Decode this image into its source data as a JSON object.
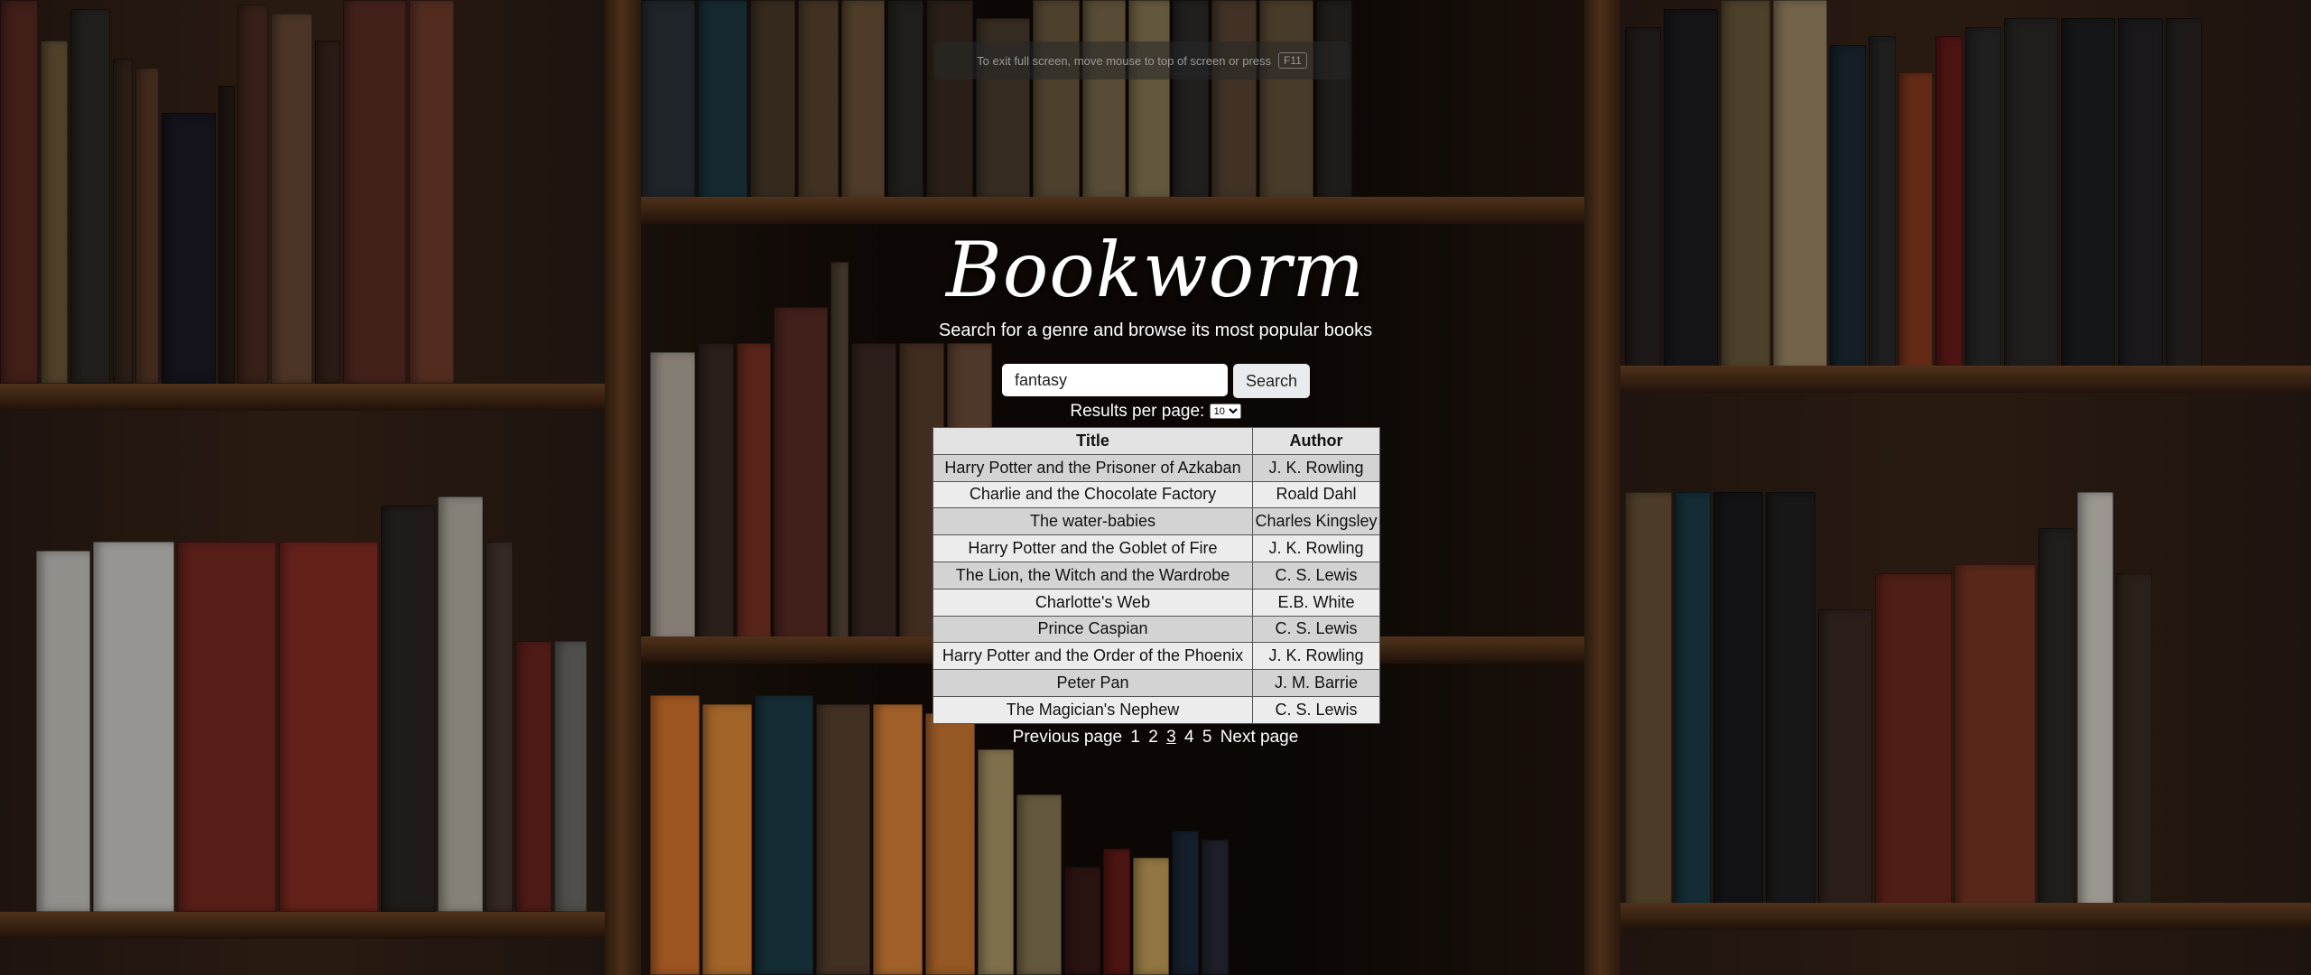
{
  "fullscreen_notice": {
    "text": "To exit full screen, move mouse to top of screen or press",
    "key": "F11"
  },
  "app": {
    "logo": "Bookworm",
    "subtitle": "Search for a genre and browse its most popular books"
  },
  "search": {
    "value": "fantasy",
    "button_label": "Search"
  },
  "results_per_page": {
    "label": "Results per page:",
    "selected": "10"
  },
  "table": {
    "headers": {
      "title": "Title",
      "author": "Author"
    },
    "rows": [
      {
        "title": "Harry Potter and the Prisoner of Azkaban",
        "author": "J. K. Rowling"
      },
      {
        "title": "Charlie and the Chocolate Factory",
        "author": "Roald Dahl"
      },
      {
        "title": "The water-babies",
        "author": "Charles Kingsley"
      },
      {
        "title": "Harry Potter and the Goblet of Fire",
        "author": "J. K. Rowling"
      },
      {
        "title": "The Lion, the Witch and the Wardrobe",
        "author": "C. S. Lewis"
      },
      {
        "title": "Charlotte's Web",
        "author": "E.B. White"
      },
      {
        "title": "Prince Caspian",
        "author": "C. S. Lewis"
      },
      {
        "title": "Harry Potter and the Order of the Phoenix",
        "author": "J. K. Rowling"
      },
      {
        "title": "Peter Pan",
        "author": "J. M. Barrie"
      },
      {
        "title": "The Magician's Nephew",
        "author": "C. S. Lewis"
      }
    ]
  },
  "pagination": {
    "previous": "Previous page",
    "pages": [
      "1",
      "2",
      "3",
      "4",
      "5"
    ],
    "current": "3",
    "next": "Next page"
  }
}
